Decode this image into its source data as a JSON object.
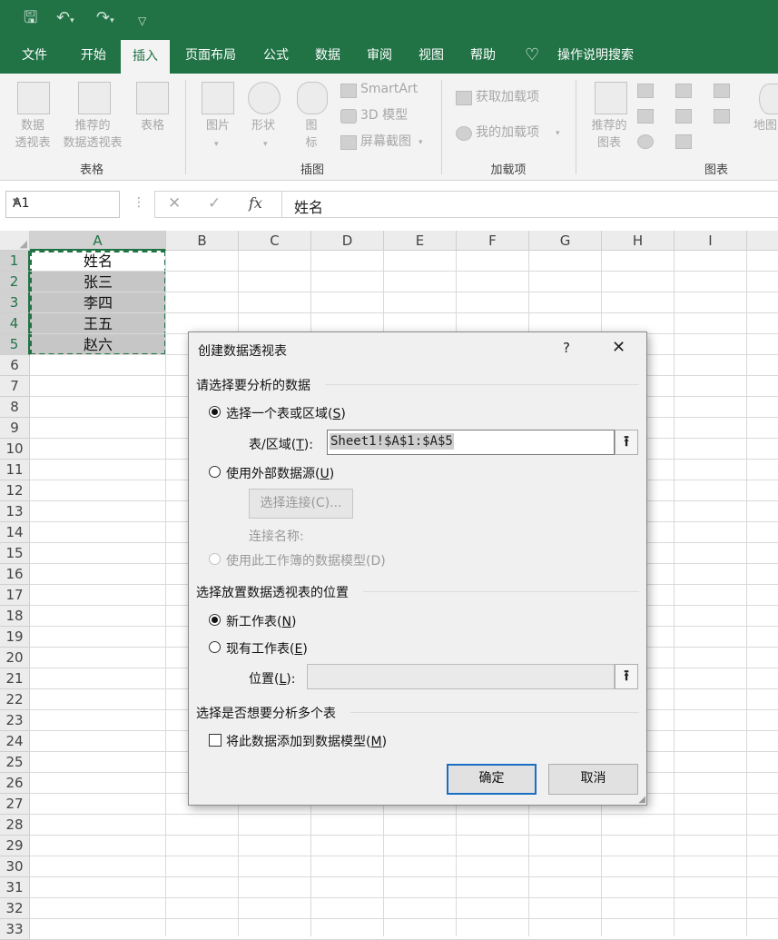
{
  "ribbon": {
    "tabs": [
      "文件",
      "开始",
      "插入",
      "页面布局",
      "公式",
      "数据",
      "审阅",
      "视图",
      "帮助"
    ],
    "active_tab": "插入",
    "search_hint": "操作说明搜索",
    "buttons": {
      "pivot_l1": "数据",
      "pivot_l2": "透视表",
      "rec_pivot_l1": "推荐的",
      "rec_pivot_l2": "数据透视表",
      "table": "表格",
      "pictures": "图片",
      "shapes": "形状",
      "icons_l1": "图",
      "icons_l2": "标",
      "smartart": "SmartArt",
      "model3d": "3D 模型",
      "screenshot": "屏幕截图",
      "get_addins": "获取加载项",
      "my_addins": "我的加载项",
      "rec_chart_l1": "推荐的",
      "rec_chart_l2": "图表",
      "map": "地图"
    },
    "groups": [
      "表格",
      "插图",
      "加载项",
      "图表"
    ]
  },
  "formula_bar": {
    "name_box": "A1",
    "fx": "fx",
    "content": "姓名"
  },
  "sheet": {
    "columns": [
      "A",
      "B",
      "C",
      "D",
      "E",
      "F",
      "G",
      "H",
      "I"
    ],
    "rows": [
      "1",
      "2",
      "3",
      "4",
      "5",
      "6",
      "7",
      "8",
      "9",
      "10",
      "11",
      "12",
      "13",
      "14",
      "15",
      "16",
      "17",
      "18",
      "19",
      "20",
      "21",
      "22",
      "23",
      "24",
      "25",
      "26",
      "27",
      "28",
      "29",
      "30",
      "31",
      "32",
      "33"
    ],
    "cells": [
      "姓名",
      "张三",
      "李四",
      "王五",
      "赵六"
    ]
  },
  "dialog": {
    "title": "创建数据透视表",
    "help": "?",
    "close": "✕",
    "section1": "请选择要分析的数据",
    "opt_select_range": "选择一个表或区域(",
    "opt_select_range_key": "S",
    "range_label": "表/区域(",
    "range_label_key": "T",
    "range_value": "Sheet1!$A$1:$A$5",
    "opt_external": "使用外部数据源(",
    "opt_external_key": "U",
    "choose_conn": "选择连接(C)...",
    "conn_name": "连接名称:",
    "opt_data_model": "使用此工作簿的数据模型(D)",
    "section2": "选择放置数据透视表的位置",
    "opt_new_sheet": "新工作表(",
    "opt_new_sheet_key": "N",
    "opt_existing": "现有工作表(",
    "opt_existing_key": "E",
    "location_label": "位置(",
    "location_label_key": "L",
    "location_value": "",
    "section3": "选择是否想要分析多个表",
    "chk_add_model": "将此数据添加到数据模型(",
    "chk_add_model_key": "M",
    "ok": "确定",
    "cancel": "取消"
  }
}
